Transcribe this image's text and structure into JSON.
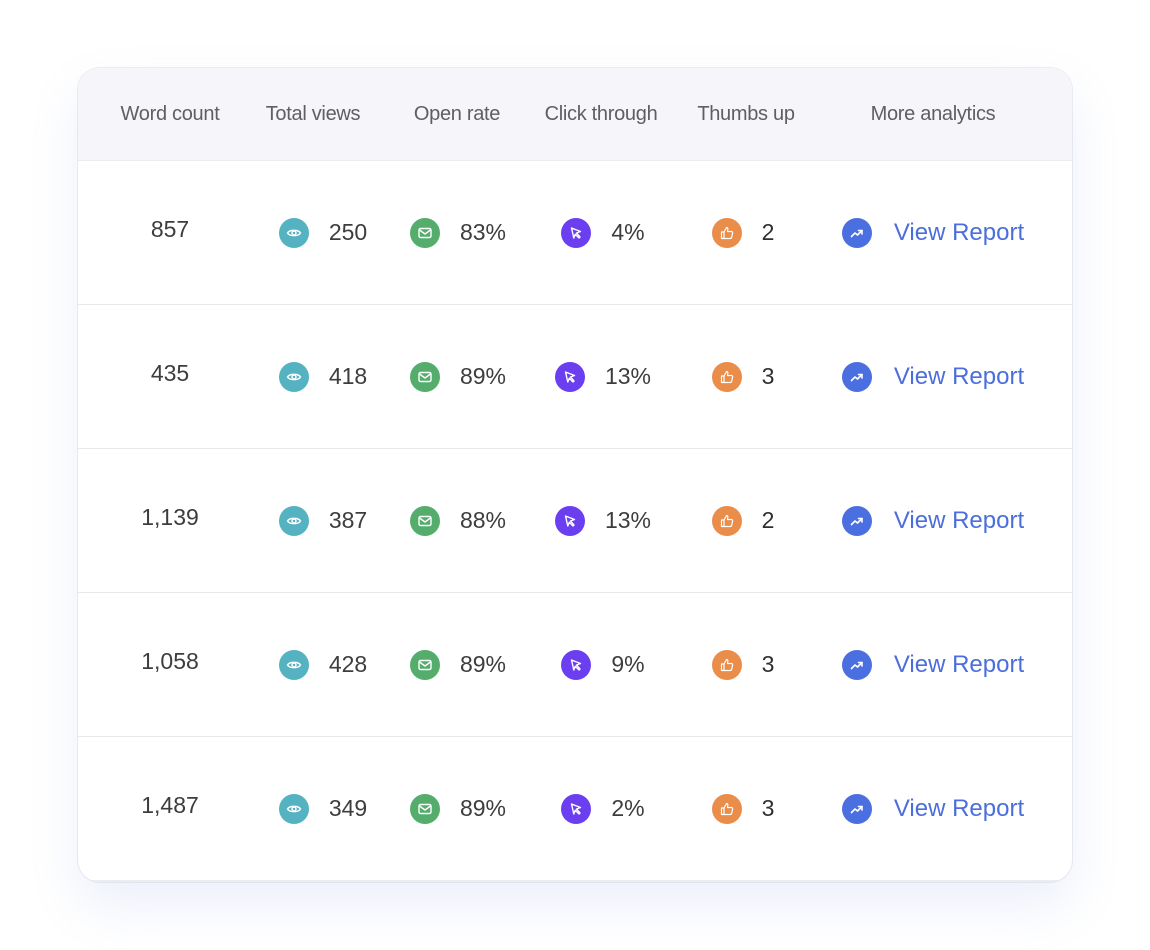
{
  "table": {
    "headers": [
      "Word count",
      "Total views",
      "Open rate",
      "Click through",
      "Thumbs up",
      "More analytics"
    ],
    "icons": {
      "total_views": "eye-icon",
      "open_rate": "mail-icon",
      "click_through": "cursor-icon",
      "thumbs_up": "thumbs-up-icon",
      "more_analytics": "trend-up-icon"
    },
    "colors": {
      "eye": "#54b2c1",
      "mail": "#54ad6c",
      "cursor": "#6b3ef0",
      "thumb": "#ea8c4a",
      "trend": "#4a6fe0",
      "link": "#4a6fdc"
    },
    "rows": [
      {
        "word_count": "857",
        "total_views": "250",
        "open_rate": "83%",
        "click_through": "4%",
        "thumbs_up": "2",
        "more_analytics": "View Report"
      },
      {
        "word_count": "435",
        "total_views": "418",
        "open_rate": "89%",
        "click_through": "13%",
        "thumbs_up": "3",
        "more_analytics": "View Report"
      },
      {
        "word_count": "1,139",
        "total_views": "387",
        "open_rate": "88%",
        "click_through": "13%",
        "thumbs_up": "2",
        "more_analytics": "View Report"
      },
      {
        "word_count": "1,058",
        "total_views": "428",
        "open_rate": "89%",
        "click_through": "9%",
        "thumbs_up": "3",
        "more_analytics": "View Report"
      },
      {
        "word_count": "1,487",
        "total_views": "349",
        "open_rate": "89%",
        "click_through": "2%",
        "thumbs_up": "3",
        "more_analytics": "View Report"
      }
    ]
  }
}
